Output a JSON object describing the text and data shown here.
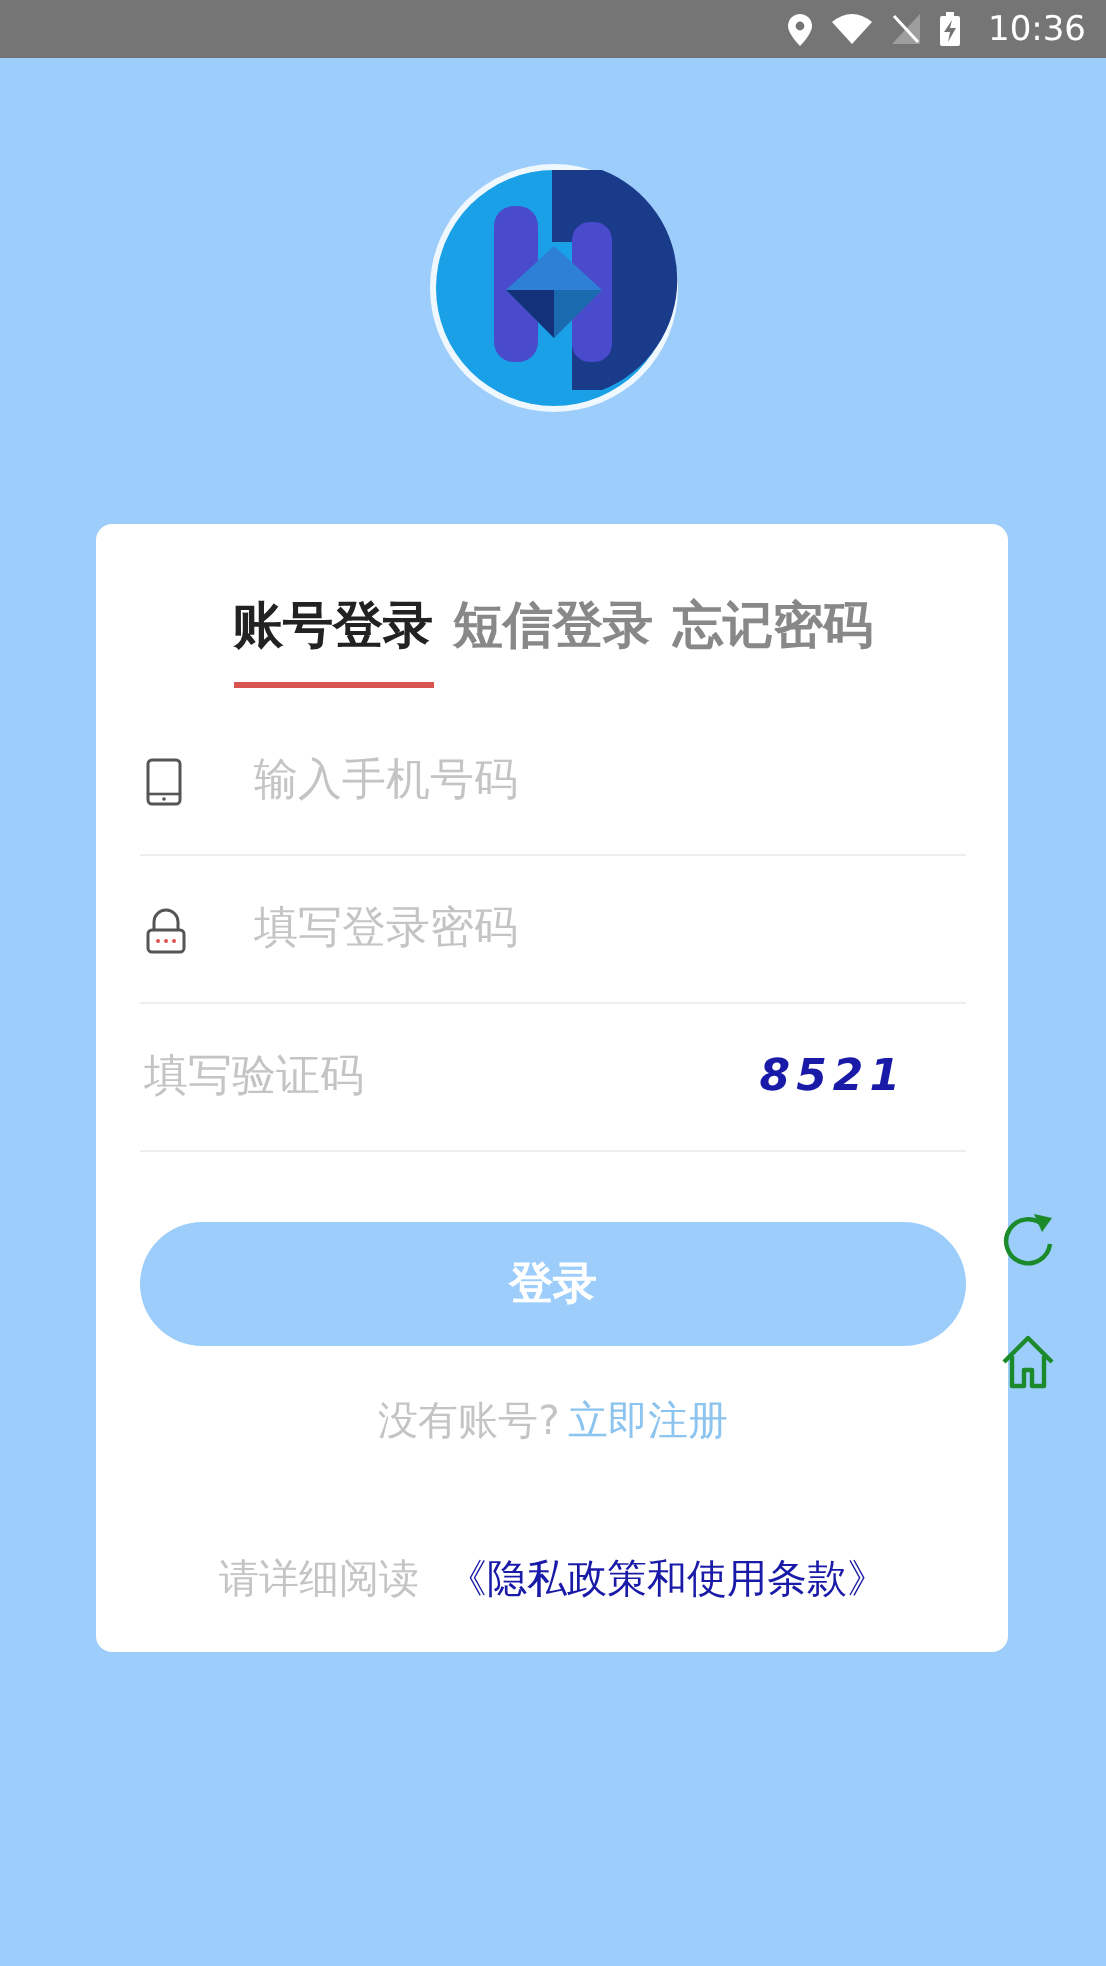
{
  "status_bar": {
    "time": "10:36"
  },
  "tabs": [
    {
      "label": "账号登录",
      "selected": true
    },
    {
      "label": "短信登录",
      "selected": false
    },
    {
      "label": "忘记密码",
      "selected": false
    }
  ],
  "fields": [
    {
      "kind": "phone",
      "placeholder": "输入手机号码"
    },
    {
      "kind": "password",
      "placeholder": "填写登录密码"
    },
    {
      "kind": "captcha",
      "placeholder": "填写验证码",
      "code": "8521"
    }
  ],
  "login_button": "登录",
  "register": {
    "prompt": "没有账号?",
    "link": "立即注册"
  },
  "terms": {
    "prefix": "请详细阅读",
    "link": "《隐私政策和使用条款》"
  }
}
